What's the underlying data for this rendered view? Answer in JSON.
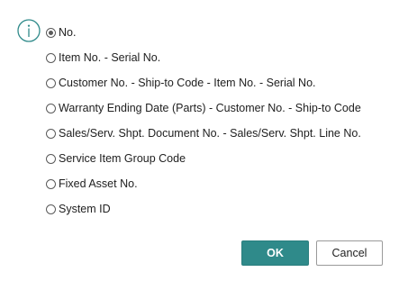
{
  "icons": {
    "info": "info-icon"
  },
  "colors": {
    "accent": "#2f8a8a",
    "info_icon": "#2f8a8a"
  },
  "options": [
    {
      "label": "No.",
      "selected": true
    },
    {
      "label": "Item No. - Serial No.",
      "selected": false
    },
    {
      "label": "Customer No. - Ship-to Code - Item No. - Serial No.",
      "selected": false
    },
    {
      "label": "Warranty Ending Date (Parts) - Customer No. - Ship-to Code",
      "selected": false
    },
    {
      "label": "Sales/Serv. Shpt. Document No. - Sales/Serv. Shpt. Line No.",
      "selected": false
    },
    {
      "label": "Service Item Group Code",
      "selected": false
    },
    {
      "label": "Fixed Asset No.",
      "selected": false
    },
    {
      "label": "System ID",
      "selected": false
    }
  ],
  "buttons": {
    "ok_label": "OK",
    "cancel_label": "Cancel"
  }
}
